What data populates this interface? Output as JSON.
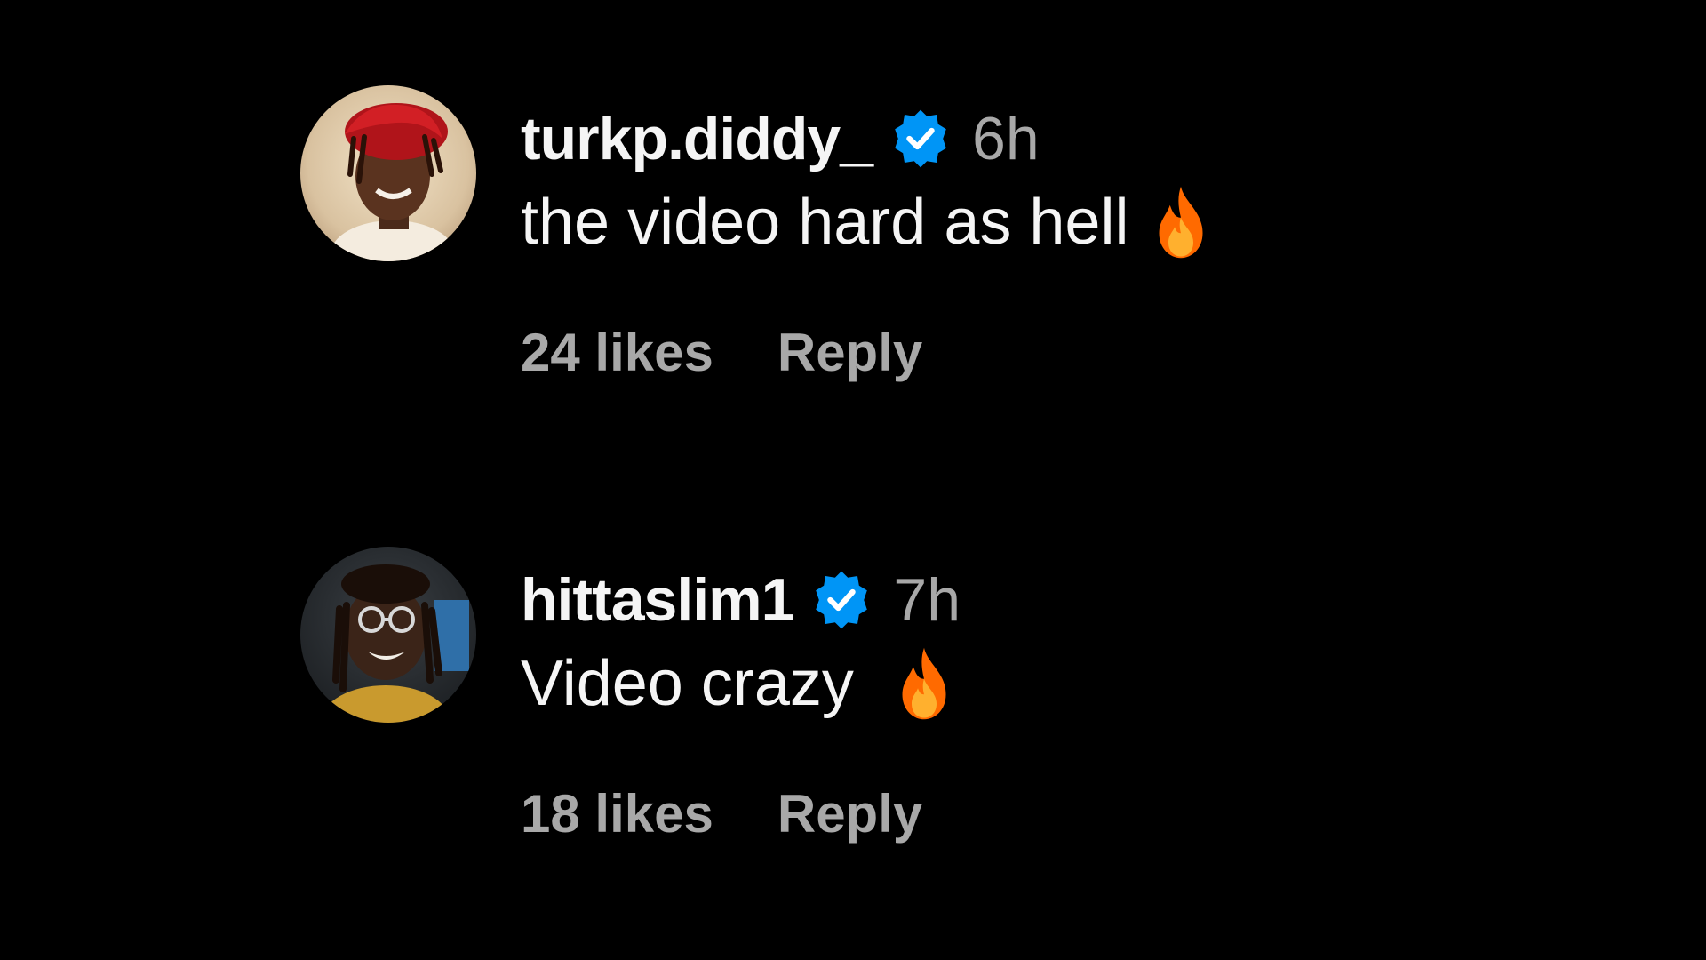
{
  "colors": {
    "background": "#000000",
    "primary_text": "#f5f5f5",
    "secondary_text": "#a8a8a8",
    "verified_blue": "#0095f6",
    "fire_orange": "#ff6a00"
  },
  "comments": [
    {
      "username": "turkp.diddy_",
      "verified_icon": "verified-badge-icon",
      "time": "6h",
      "text": "the video hard as hell",
      "emoji_icon": "fire-emoji-icon",
      "likes": "24 likes",
      "reply_label": "Reply"
    },
    {
      "username": "hittaslim1",
      "verified_icon": "verified-badge-icon",
      "time": "7h",
      "text": "Video crazy ",
      "emoji_icon": "fire-emoji-icon",
      "likes": "18 likes",
      "reply_label": "Reply"
    }
  ]
}
